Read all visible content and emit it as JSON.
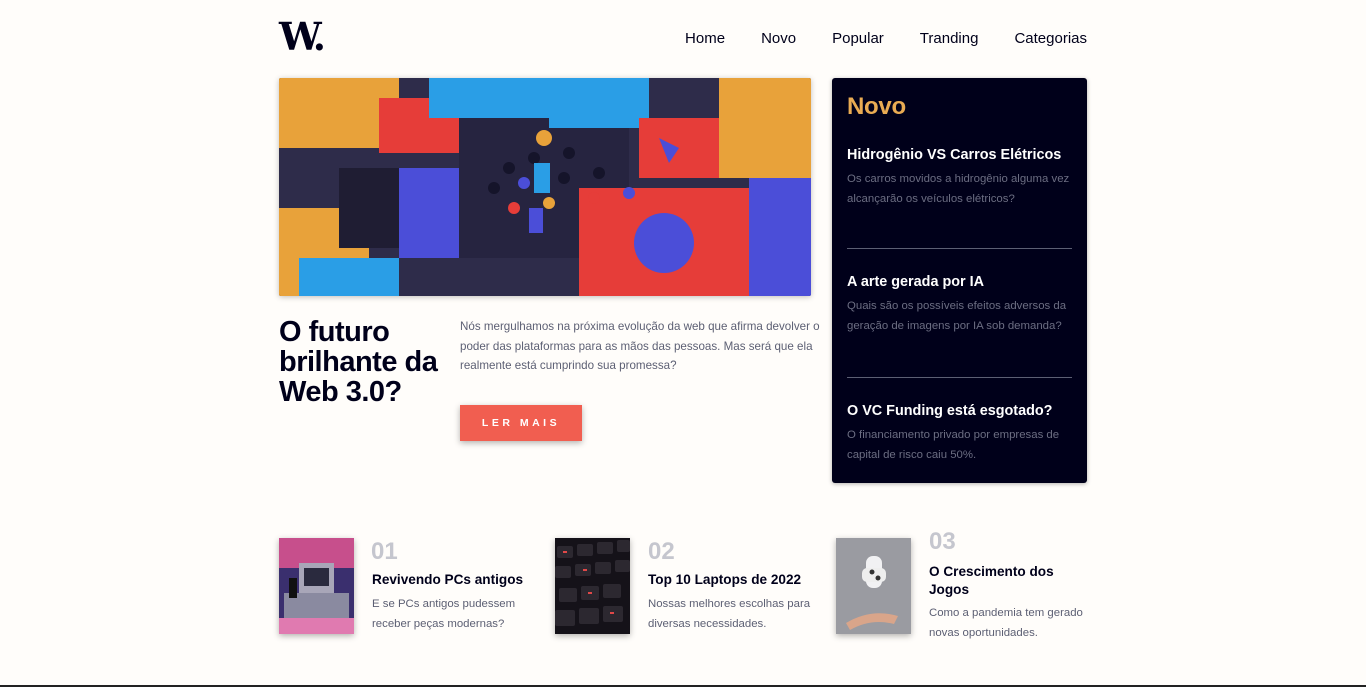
{
  "header": {
    "logo": "W.",
    "nav": [
      "Home",
      "Novo",
      "Popular",
      "Tranding",
      "Categorias"
    ]
  },
  "hero": {
    "title": "O futuro brilhante da Web 3.0?",
    "text": "Nós mergulhamos na próxima evolução da web que afirma devolver o poder das plataformas para as mãos das pessoas. Mas será que ela realmente está cumprindo sua promessa?",
    "button": "LER MAIS"
  },
  "novo": {
    "heading": "Novo",
    "items": [
      {
        "title": "Hidrogênio VS Carros Elétricos",
        "text": "Os carros movidos a hidrogênio alguma vez alcançarão os veículos elétricos?"
      },
      {
        "title": "A arte gerada por IA",
        "text": "Quais são os possíveis efeitos adversos da geração de imagens por IA sob demanda?"
      },
      {
        "title": "O VC Funding está esgotado?",
        "text": "O financiamento privado por empresas de capital de risco caiu 50%."
      }
    ]
  },
  "cards": [
    {
      "num": "01",
      "title": "Revivendo PCs antigos",
      "text": "E se PCs antigos pudessem receber peças modernas?"
    },
    {
      "num": "02",
      "title": "Top 10 Laptops de 2022",
      "text": "Nossas melhores escolhas para diversas necessidades."
    },
    {
      "num": "03",
      "title": "O Crescimento dos Jogos",
      "text": "Como a pandemia tem gerado novas oportunidades."
    }
  ],
  "colors": {
    "accent_orange": "#e9ab53",
    "button_red": "#f15e50",
    "dark_navy": "#00001a",
    "background": "#fffdfa"
  }
}
